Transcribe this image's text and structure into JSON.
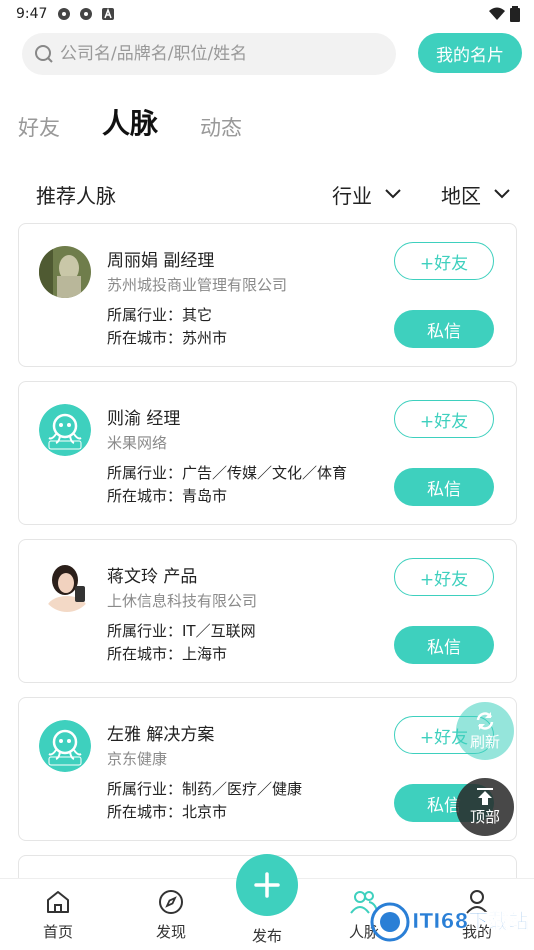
{
  "status": {
    "time": "9:47"
  },
  "search": {
    "placeholder": "公司名/品牌名/职位/姓名"
  },
  "header": {
    "card_button": "我的名片"
  },
  "tabs": [
    "好友",
    "人脉",
    "动态"
  ],
  "filter": {
    "title": "推荐人脉",
    "industry": "行业",
    "region": "地区"
  },
  "cards": [
    {
      "name": "周丽娟 副经理",
      "company": "苏州城投商业管理有限公司",
      "industry": "所属行业：其它",
      "city": "所在城市：苏州市",
      "friend": "+好友",
      "msg": "私信"
    },
    {
      "name": "则渝 经理",
      "company": "米果网络",
      "industry": "所属行业：广告／传媒／文化／体育",
      "city": "所在城市：青岛市",
      "friend": "+好友",
      "msg": "私信"
    },
    {
      "name": "蒋文玲 产品",
      "company": "上休信息科技有限公司",
      "industry": "所属行业：IT／互联网",
      "city": "所在城市：上海市",
      "friend": "+好友",
      "msg": "私信"
    },
    {
      "name": "左雅 解决方案",
      "company": "京东健康",
      "industry": "所属行业：制药／医疗／健康",
      "city": "所在城市：北京市",
      "friend": "+好友",
      "msg": "私信"
    }
  ],
  "floating": {
    "refresh": "刷新",
    "top": "顶部"
  },
  "nav": {
    "home": "首页",
    "discover": "发现",
    "publish": "发布",
    "network": "人脉",
    "mine": "我的"
  },
  "watermark": {
    "text": "ITI68下载站"
  },
  "colors": {
    "accent": "#3ed0be"
  }
}
